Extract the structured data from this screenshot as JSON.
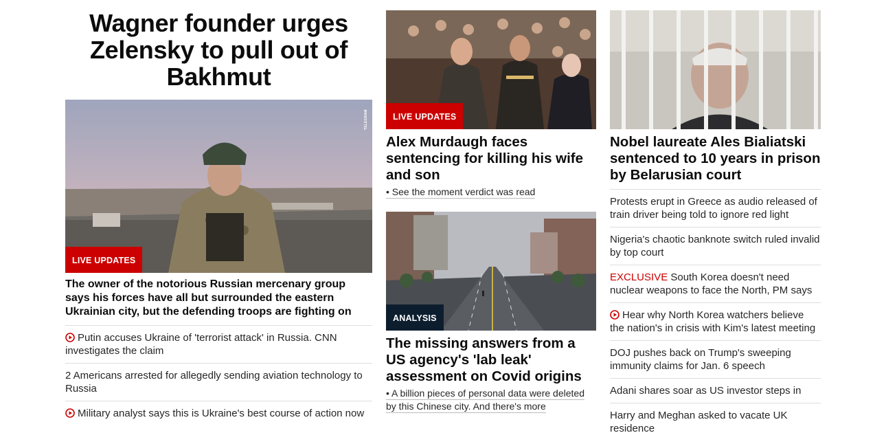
{
  "left": {
    "title": "Wagner founder urges Zelensky to pull out of Bakhmut",
    "image_alt": "Wagner founder in military gear",
    "image_credit": "TELEGRAM",
    "badge": "LIVE UPDATES",
    "lede": "The owner of the notorious Russian mercenary group says his forces have all but surrounded the eastern Ukrainian city, but the defending troops are fighting on",
    "links": [
      {
        "video": true,
        "text": "Putin accuses Ukraine of 'terrorist attack' in Russia. CNN investigates the claim"
      },
      {
        "video": false,
        "text": "2 Americans arrested for allegedly sending aviation technology to Russia"
      },
      {
        "video": true,
        "text": "Military analyst says this is Ukraine's best course of action now"
      }
    ]
  },
  "middle": {
    "story1": {
      "badge": "LIVE UPDATES",
      "headline": "Alex Murdaugh faces sentencing for killing his wife and son",
      "sublink": "• See the moment verdict was read"
    },
    "story2": {
      "badge": "ANALYSIS",
      "headline": "The missing answers from a US agency's 'lab leak' assessment on Covid origins",
      "sublink": "• A billion pieces of personal data were deleted by this Chinese city. And there's more"
    }
  },
  "right": {
    "headline": "Nobel laureate Ales Bialiatski sentenced to 10 years in prison by Belarusian court",
    "links": [
      {
        "text": "Protests erupt in Greece as audio released of train driver being told to ignore red light"
      },
      {
        "text": "Nigeria's chaotic banknote switch ruled invalid by top court"
      },
      {
        "prefix": "EXCLUSIVE",
        "text": " South Korea doesn't need nuclear weapons to face the North, PM says"
      },
      {
        "video": true,
        "text": "Hear why North Korea watchers believe the nation's in crisis with Kim's latest meeting"
      },
      {
        "text": "DOJ pushes back on Trump's sweeping immunity claims for Jan. 6 speech"
      },
      {
        "text": "Adani shares soar as US investor steps in"
      },
      {
        "text": "Harry and Meghan asked to vacate UK residence"
      }
    ]
  },
  "colors": {
    "accent_red": "#cc0000",
    "analysis_badge": "#0c1e2e"
  }
}
